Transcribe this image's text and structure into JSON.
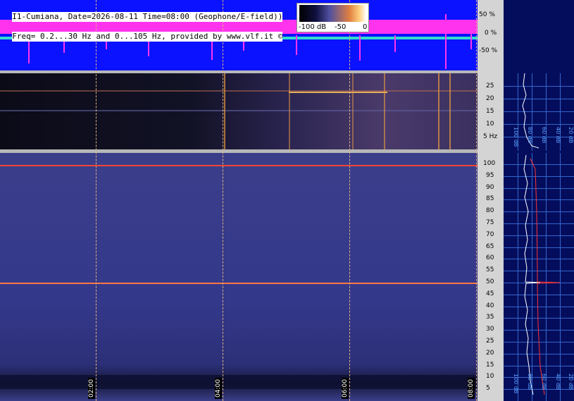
{
  "header": {
    "line1": "I1-Cumiana, Date=2026-08-11 Time=08:00 (Geophone/E-field))",
    "line2": "Freq= 0.2...30 Hz and 0...105 Hz, provided by www.vlf.it ©"
  },
  "colorbar": {
    "labels": [
      "-100 dB",
      "-50",
      "0"
    ]
  },
  "waveform_axis": [
    "50 %",
    "0 %",
    "-50 %"
  ],
  "elf_axis": [
    "25",
    "20",
    "15",
    "10",
    "5 Hz"
  ],
  "vlf_axis": [
    "100",
    "95",
    "90",
    "85",
    "80",
    "75",
    "70",
    "65",
    "60",
    "55",
    "50",
    "45",
    "40",
    "35",
    "30",
    "25",
    "20",
    "15",
    "10",
    "5"
  ],
  "time_labels": [
    "02:00",
    "04:00",
    "06:00",
    "08:00"
  ],
  "side_labels_top": [
    "100 dB",
    "80 dB",
    "60 dB",
    "40 dB",
    "20 dB"
  ],
  "side_labels_bottom": [
    "100 dB",
    "80 dB",
    "60 dB",
    "40 dB",
    "20 dB"
  ],
  "colors": {
    "waveform_bg": "#0a12ff",
    "waveform_trace": "#ff33ee",
    "baseline": "#33ddcc",
    "hum_line": "#ff4433",
    "side_bg": "#040d5c",
    "grid": "#3366cc"
  }
}
